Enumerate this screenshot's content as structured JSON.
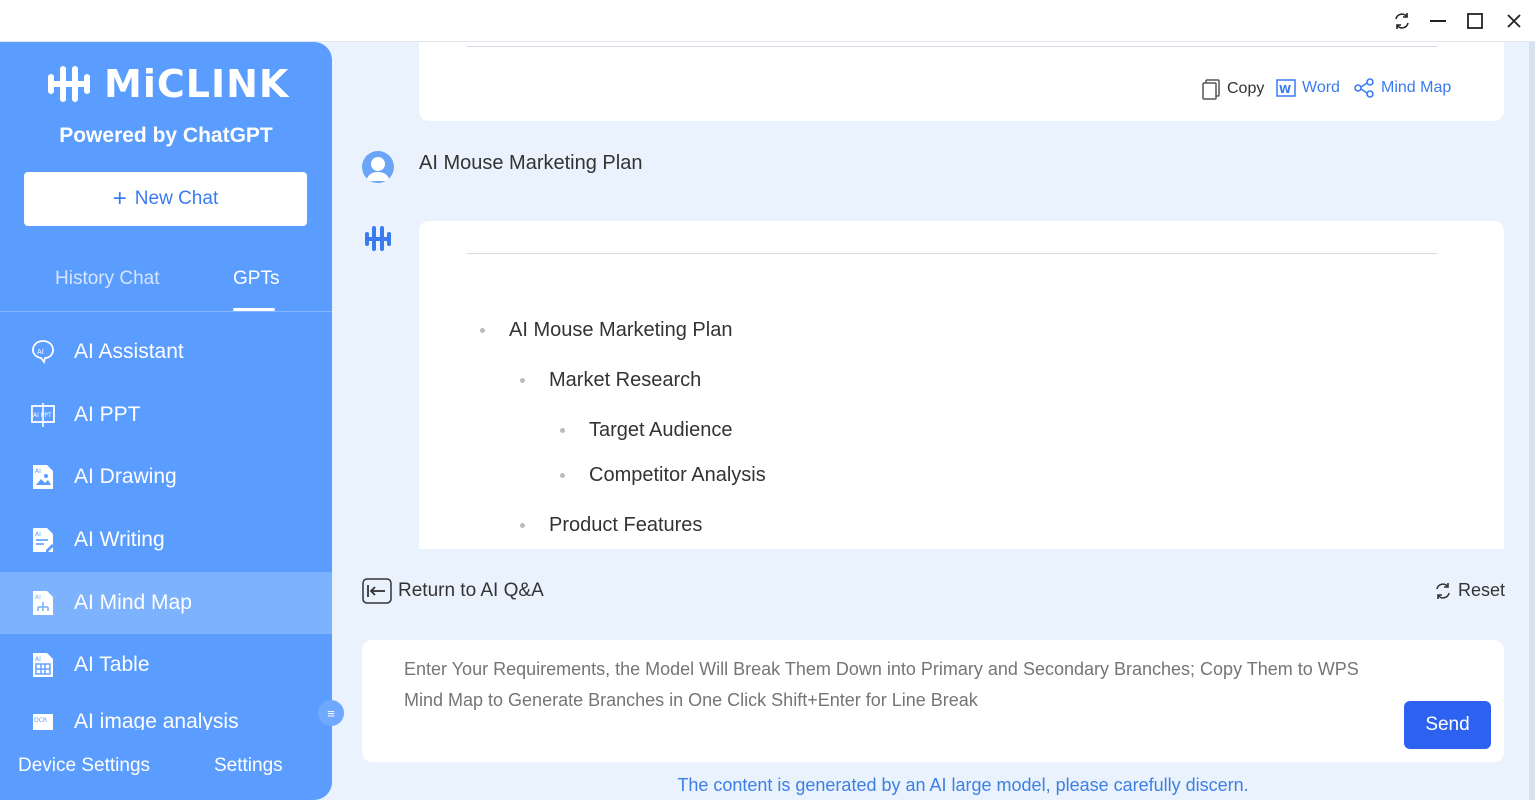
{
  "window": {
    "controls": [
      "refresh-icon",
      "minimize-icon",
      "maximize-icon",
      "close-icon"
    ]
  },
  "sidebar": {
    "logo_text": "MiCLINK",
    "powered_by": "Powered by ChatGPT",
    "new_chat_label": "New Chat",
    "tabs": [
      {
        "label": "History Chat",
        "active": false
      },
      {
        "label": "GPTs",
        "active": true
      }
    ],
    "items": [
      {
        "label": "AI Assistant",
        "icon": "ai-assistant-icon"
      },
      {
        "label": "AI PPT",
        "icon": "ai-ppt-icon"
      },
      {
        "label": "AI Drawing",
        "icon": "ai-drawing-icon"
      },
      {
        "label": "AI Writing",
        "icon": "ai-writing-icon"
      },
      {
        "label": "AI Mind Map",
        "icon": "ai-mind-map-icon",
        "active": true
      },
      {
        "label": "AI Table",
        "icon": "ai-table-icon"
      },
      {
        "label": "AI image analysis",
        "icon": "ai-image-analysis-icon"
      }
    ],
    "footer": {
      "device_settings": "Device Settings",
      "settings": "Settings"
    }
  },
  "conversation": {
    "prev_actions": {
      "copy": "Copy",
      "word": "Word",
      "mind_map": "Mind Map"
    },
    "user_message": "AI Mouse Marketing Plan",
    "reply_outline": [
      {
        "level": 0,
        "text": "AI Mouse Marketing Plan"
      },
      {
        "level": 1,
        "text": "Market Research"
      },
      {
        "level": 2,
        "text": "Target Audience"
      },
      {
        "level": 2,
        "text": "Competitor Analysis"
      },
      {
        "level": 1,
        "text": "Product Features"
      }
    ]
  },
  "controls": {
    "return_label": "Return to AI Q&A",
    "reset_label": "Reset"
  },
  "input": {
    "placeholder": "Enter Your Requirements, the Model Will Break Them Down into Primary and Secondary Branches; Copy Them to WPS Mind Map to Generate Branches in One Click Shift+Enter for Line Break",
    "send_label": "Send"
  },
  "disclaimer": "The content is generated by an AI large model, please carefully discern.",
  "colors": {
    "sidebar": "#5b9cff",
    "active_item": "#7db2ff",
    "accent": "#2d62f0",
    "link": "#3a7bf0",
    "background": "#eaf3fd"
  }
}
